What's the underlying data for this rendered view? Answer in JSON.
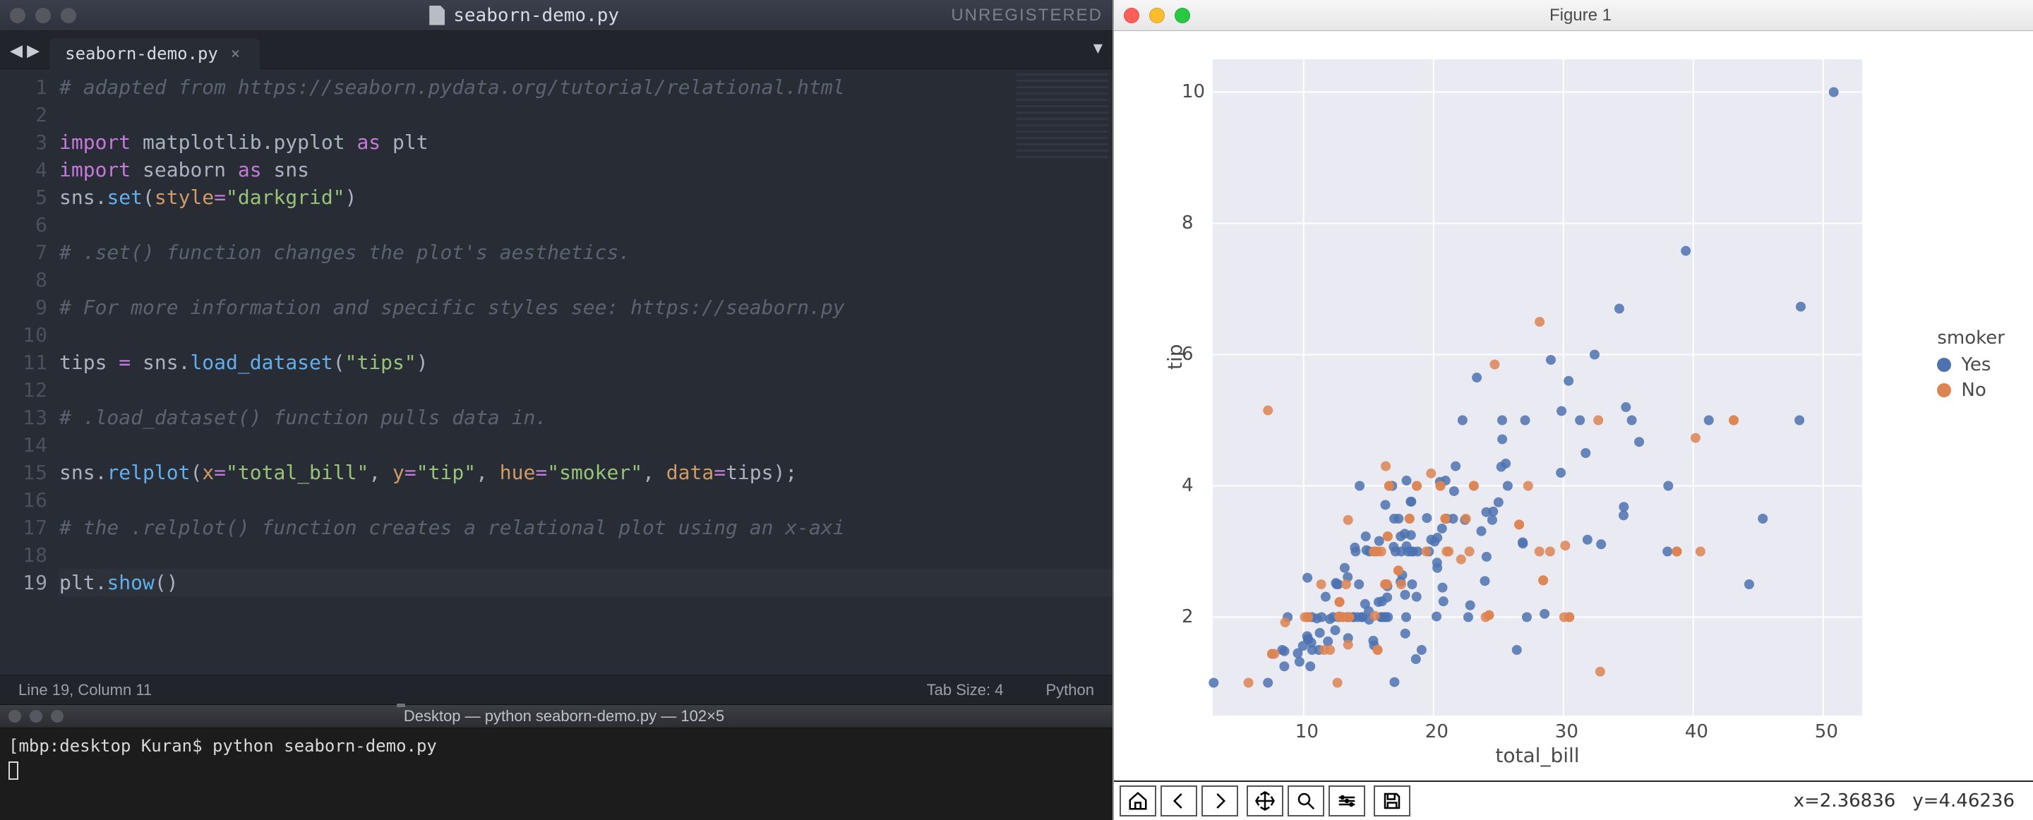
{
  "editor": {
    "title": "seaborn-demo.py",
    "registration": "UNREGISTERED",
    "tab_label": "seaborn-demo.py",
    "status": {
      "pos": "Line 19, Column 11",
      "tabsize": "Tab Size: 4",
      "lang": "Python"
    },
    "code_lines": [
      {
        "n": 1,
        "html": "<span class='c-comment'># adapted from https://seaborn.pydata.org/tutorial/relational.html</span>"
      },
      {
        "n": 2,
        "html": ""
      },
      {
        "n": 3,
        "html": "<span class='c-kw'>import</span> <span class='c-mod'>matplotlib.pyplot</span> <span class='c-kw'>as</span> <span class='c-mod'>plt</span>"
      },
      {
        "n": 4,
        "html": "<span class='c-kw'>import</span> <span class='c-mod'>seaborn</span> <span class='c-kw'>as</span> <span class='c-mod'>sns</span>"
      },
      {
        "n": 5,
        "html": "<span class='c-mod'>sns</span><span class='c-punct'>.</span><span class='c-func'>set</span><span class='c-punct'>(</span><span class='c-param'>style</span><span class='c-op'>=</span><span class='c-str'>\"darkgrid\"</span><span class='c-punct'>)</span>"
      },
      {
        "n": 6,
        "html": ""
      },
      {
        "n": 7,
        "html": "<span class='c-comment'># .set() function changes the plot's aesthetics.</span>"
      },
      {
        "n": 8,
        "html": ""
      },
      {
        "n": 9,
        "html": "<span class='c-comment'># For more information and specific styles see: https://seaborn.py</span>"
      },
      {
        "n": 10,
        "html": ""
      },
      {
        "n": 11,
        "html": "<span class='c-mod'>tips</span> <span class='c-op'>=</span> <span class='c-mod'>sns</span><span class='c-punct'>.</span><span class='c-func'>load_dataset</span><span class='c-punct'>(</span><span class='c-str'>\"tips\"</span><span class='c-punct'>)</span>"
      },
      {
        "n": 12,
        "html": ""
      },
      {
        "n": 13,
        "html": "<span class='c-comment'># .load_dataset() function pulls data in.</span>"
      },
      {
        "n": 14,
        "html": ""
      },
      {
        "n": 15,
        "html": "<span class='c-mod'>sns</span><span class='c-punct'>.</span><span class='c-func'>relplot</span><span class='c-punct'>(</span><span class='c-param'>x</span><span class='c-op'>=</span><span class='c-str'>\"total_bill\"</span><span class='c-punct'>, </span><span class='c-param'>y</span><span class='c-op'>=</span><span class='c-str'>\"tip\"</span><span class='c-punct'>, </span><span class='c-param'>hue</span><span class='c-op'>=</span><span class='c-str'>\"smoker\"</span><span class='c-punct'>, </span><span class='c-param'>data</span><span class='c-op'>=</span><span class='c-mod'>tips</span><span class='c-punct'>);</span>"
      },
      {
        "n": 16,
        "html": ""
      },
      {
        "n": 17,
        "html": "<span class='c-comment'># the .relplot() function creates a relational plot using an x-axi</span>"
      },
      {
        "n": 18,
        "html": ""
      },
      {
        "n": 19,
        "html": "<span class='c-mod'>plt</span><span class='c-punct'>.</span><span class='c-func'>show</span><span class='c-punct'>()</span>",
        "cursor": true
      }
    ]
  },
  "terminal": {
    "title": "Desktop — python seaborn-demo.py — 102×5",
    "prompt": "[mbp:desktop Kuran$ ",
    "command": "python seaborn-demo.py"
  },
  "figure": {
    "title": "Figure 1",
    "coord_x": "x=2.36836",
    "coord_y": "y=4.46236"
  },
  "chart_data": {
    "type": "scatter",
    "xlabel": "total_bill",
    "ylabel": "tip",
    "xlim": [
      3,
      53
    ],
    "ylim": [
      0.5,
      10.5
    ],
    "xticks": [
      10,
      20,
      30,
      40,
      50
    ],
    "yticks": [
      2,
      4,
      6,
      8,
      10
    ],
    "legend_title": "smoker",
    "colors": {
      "Yes": "#4c72b0",
      "No": "#dd8452"
    },
    "series": [
      {
        "name": "Yes",
        "points": [
          [
            16.99,
            1.01
          ],
          [
            10.34,
            1.66
          ],
          [
            21.01,
            3.5
          ],
          [
            23.68,
            3.31
          ],
          [
            24.59,
            3.61
          ],
          [
            25.29,
            4.71
          ],
          [
            8.77,
            2.0
          ],
          [
            26.88,
            3.12
          ],
          [
            15.04,
            1.96
          ],
          [
            14.78,
            3.23
          ],
          [
            10.27,
            1.71
          ],
          [
            35.26,
            5.0
          ],
          [
            15.42,
            1.57
          ],
          [
            18.43,
            3.0
          ],
          [
            14.83,
            3.02
          ],
          [
            21.58,
            3.92
          ],
          [
            10.33,
            1.67
          ],
          [
            16.29,
            3.71
          ],
          [
            16.97,
            3.5
          ],
          [
            20.65,
            3.35
          ],
          [
            17.92,
            4.08
          ],
          [
            20.29,
            2.75
          ],
          [
            15.77,
            2.23
          ],
          [
            39.42,
            7.58
          ],
          [
            19.82,
            3.18
          ],
          [
            17.81,
            2.34
          ],
          [
            13.37,
            2.0
          ],
          [
            12.69,
            2.0
          ],
          [
            21.7,
            4.3
          ],
          [
            19.65,
            3.0
          ],
          [
            9.55,
            1.45
          ],
          [
            18.35,
            2.5
          ],
          [
            15.06,
            3.0
          ],
          [
            20.69,
            2.45
          ],
          [
            17.78,
            3.27
          ],
          [
            24.06,
            3.6
          ],
          [
            16.31,
            2.0
          ],
          [
            16.93,
            3.07
          ],
          [
            18.69,
            2.31
          ],
          [
            31.27,
            5.0
          ],
          [
            16.04,
            2.24
          ],
          [
            17.46,
            2.54
          ],
          [
            13.94,
            3.06
          ],
          [
            9.68,
            1.32
          ],
          [
            30.4,
            5.6
          ],
          [
            18.29,
            3.0
          ],
          [
            22.23,
            5.0
          ],
          [
            32.4,
            6.0
          ],
          [
            28.55,
            2.05
          ],
          [
            18.04,
            3.0
          ],
          [
            12.54,
            2.5
          ],
          [
            10.29,
            2.6
          ],
          [
            34.81,
            5.2
          ],
          [
            9.94,
            1.56
          ],
          [
            25.56,
            4.34
          ],
          [
            19.49,
            3.51
          ],
          [
            38.01,
            3.0
          ],
          [
            26.41,
            1.5
          ],
          [
            11.24,
            1.76
          ],
          [
            48.27,
            6.73
          ],
          [
            20.29,
            3.21
          ],
          [
            13.81,
            2.0
          ],
          [
            11.02,
            1.98
          ],
          [
            18.29,
            3.76
          ],
          [
            17.59,
            2.64
          ],
          [
            20.08,
            3.15
          ],
          [
            16.45,
            2.47
          ],
          [
            3.07,
            1.0
          ],
          [
            20.23,
            2.01
          ],
          [
            15.01,
            2.09
          ],
          [
            12.02,
            1.97
          ],
          [
            17.07,
            3.0
          ],
          [
            26.86,
            3.14
          ],
          [
            25.28,
            5.0
          ],
          [
            14.73,
            2.2
          ],
          [
            10.51,
            1.25
          ],
          [
            17.92,
            3.08
          ],
          [
            44.3,
            2.5
          ],
          [
            22.42,
            3.48
          ],
          [
            20.92,
            4.08
          ],
          [
            15.36,
            1.64
          ],
          [
            20.49,
            4.06
          ],
          [
            25.21,
            4.29
          ],
          [
            18.24,
            3.76
          ],
          [
            14.31,
            4.0
          ],
          [
            14.0,
            3.0
          ],
          [
            7.25,
            1.0
          ],
          [
            38.07,
            4.0
          ],
          [
            23.95,
            2.55
          ],
          [
            25.71,
            4.0
          ],
          [
            17.31,
            3.5
          ],
          [
            10.65,
            1.5
          ],
          [
            12.43,
            1.8
          ],
          [
            24.08,
            2.92
          ],
          [
            11.69,
            2.31
          ],
          [
            13.42,
            1.68
          ],
          [
            14.26,
            2.5
          ],
          [
            15.95,
            2.0
          ],
          [
            12.48,
            2.52
          ],
          [
            29.8,
            4.2
          ],
          [
            8.52,
            1.48
          ],
          [
            14.52,
            2.0
          ],
          [
            11.38,
            2.0
          ],
          [
            22.82,
            2.18
          ],
          [
            19.08,
            1.5
          ],
          [
            20.27,
            2.83
          ],
          [
            11.17,
            1.5
          ],
          [
            12.26,
            2.0
          ],
          [
            18.26,
            3.25
          ],
          [
            8.51,
            1.25
          ],
          [
            10.33,
            2.0
          ],
          [
            14.15,
            2.0
          ],
          [
            16.0,
            2.0
          ],
          [
            13.16,
            2.75
          ],
          [
            17.47,
            3.23
          ],
          [
            34.3,
            6.7
          ],
          [
            41.19,
            5.0
          ],
          [
            27.05,
            5.0
          ],
          [
            16.43,
            2.3
          ],
          [
            8.35,
            1.5
          ],
          [
            18.64,
            1.36
          ],
          [
            11.87,
            1.63
          ],
          [
            29.85,
            5.14
          ],
          [
            48.17,
            5.0
          ],
          [
            25.0,
            3.75
          ],
          [
            13.39,
            2.61
          ],
          [
            16.49,
            2.0
          ],
          [
            21.5,
            3.5
          ],
          [
            12.66,
            2.5
          ],
          [
            16.21,
            2.0
          ],
          [
            13.81,
            2.0
          ],
          [
            17.51,
            3.0
          ],
          [
            24.52,
            3.48
          ],
          [
            20.76,
            2.24
          ],
          [
            31.71,
            4.5
          ],
          [
            10.59,
            1.61
          ],
          [
            10.63,
            2.0
          ],
          [
            50.81,
            10.0
          ],
          [
            15.81,
            3.16
          ],
          [
            31.85,
            3.18
          ],
          [
            16.82,
            4.0
          ],
          [
            32.9,
            3.11
          ],
          [
            17.89,
            2.0
          ],
          [
            14.48,
            2.0
          ],
          [
            34.63,
            3.55
          ],
          [
            34.65,
            3.68
          ],
          [
            23.33,
            5.65
          ],
          [
            45.35,
            3.5
          ],
          [
            35.83,
            4.67
          ],
          [
            29.03,
            5.92
          ],
          [
            27.18,
            2.0
          ],
          [
            22.67,
            2.0
          ],
          [
            17.82,
            1.75
          ],
          [
            18.78,
            3.0
          ]
        ]
      },
      {
        "name": "No",
        "points": [
          [
            38.73,
            3.0
          ],
          [
            17.29,
            2.71
          ],
          [
            19.44,
            3.0
          ],
          [
            32.68,
            5.0
          ],
          [
            28.97,
            3.0
          ],
          [
            5.75,
            1.0
          ],
          [
            16.32,
            4.3
          ],
          [
            40.17,
            4.73
          ],
          [
            27.28,
            4.0
          ],
          [
            12.03,
            1.5
          ],
          [
            21.01,
            3.0
          ],
          [
            11.35,
            2.5
          ],
          [
            15.38,
            3.0
          ],
          [
            7.25,
            5.15
          ],
          [
            12.76,
            2.23
          ],
          [
            13.27,
            2.5
          ],
          [
            28.17,
            6.5
          ],
          [
            11.59,
            1.5
          ],
          [
            7.74,
            1.44
          ],
          [
            30.14,
            3.09
          ],
          [
            20.9,
            3.5
          ],
          [
            30.06,
            2.0
          ],
          [
            22.12,
            2.88
          ],
          [
            24.01,
            2.0
          ],
          [
            15.69,
            3.0
          ],
          [
            15.53,
            3.0
          ],
          [
            12.6,
            1.0
          ],
          [
            32.83,
            1.17
          ],
          [
            40.55,
            3.0
          ],
          [
            20.9,
            3.5
          ],
          [
            24.71,
            5.85
          ],
          [
            15.48,
            2.02
          ],
          [
            13.0,
            2.0
          ],
          [
            13.51,
            2.0
          ],
          [
            18.71,
            4.0
          ],
          [
            12.74,
            2.01
          ],
          [
            13.0,
            2.0
          ],
          [
            16.4,
            2.5
          ],
          [
            20.53,
            4.0
          ],
          [
            16.47,
            3.23
          ],
          [
            26.59,
            3.41
          ],
          [
            38.73,
            3.0
          ],
          [
            24.27,
            2.03
          ],
          [
            12.76,
            2.23
          ],
          [
            30.46,
            2.0
          ],
          [
            18.15,
            3.5
          ],
          [
            23.1,
            4.0
          ],
          [
            15.69,
            1.5
          ],
          [
            28.44,
            2.56
          ],
          [
            16.58,
            4.0
          ],
          [
            7.56,
            1.44
          ],
          [
            10.34,
            2.0
          ],
          [
            43.11,
            5.0
          ],
          [
            13.0,
            2.0
          ],
          [
            13.42,
            3.48
          ],
          [
            8.58,
            1.92
          ],
          [
            13.42,
            1.58
          ],
          [
            16.27,
            2.5
          ],
          [
            10.09,
            2.0
          ],
          [
            22.49,
            3.5
          ],
          [
            19.81,
            4.19
          ],
          [
            43.11,
            5.0
          ],
          [
            13.0,
            2.0
          ],
          [
            12.74,
            2.01
          ],
          [
            13.0,
            2.0
          ],
          [
            16.4,
            2.5
          ],
          [
            20.53,
            4.0
          ],
          [
            16.47,
            3.23
          ],
          [
            26.59,
            3.41
          ],
          [
            38.73,
            3.0
          ],
          [
            24.27,
            2.03
          ],
          [
            12.76,
            2.23
          ],
          [
            30.46,
            2.0
          ],
          [
            18.15,
            3.5
          ],
          [
            23.1,
            4.0
          ],
          [
            15.69,
            1.5
          ],
          [
            28.44,
            2.56
          ],
          [
            16.58,
            4.0
          ],
          [
            7.56,
            1.44
          ],
          [
            10.34,
            2.0
          ],
          [
            13.0,
            2.0
          ],
          [
            13.51,
            2.0
          ],
          [
            18.71,
            4.0
          ],
          [
            21.16,
            3.0
          ],
          [
            17.51,
            2.5
          ],
          [
            28.15,
            3.0
          ],
          [
            15.98,
            3.0
          ],
          [
            16.27,
            2.5
          ],
          [
            22.76,
            3.0
          ],
          [
            17.29,
            2.71
          ]
        ]
      }
    ]
  }
}
